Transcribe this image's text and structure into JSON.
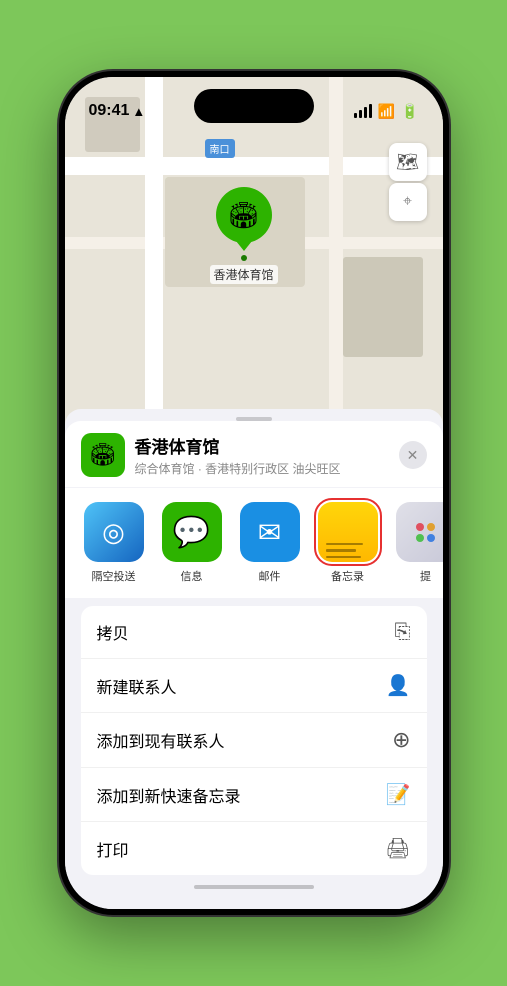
{
  "status_bar": {
    "time": "09:41",
    "location_arrow": "▶"
  },
  "map": {
    "label": "南口",
    "label_prefix": "南口"
  },
  "pin": {
    "label": "香港体育馆"
  },
  "venue": {
    "name": "香港体育馆",
    "subtitle": "综合体育馆 · 香港特别行政区 油尖旺区"
  },
  "share_items": [
    {
      "id": "airdrop",
      "label": "隔空投送",
      "type": "airdrop"
    },
    {
      "id": "messages",
      "label": "信息",
      "type": "messages"
    },
    {
      "id": "mail",
      "label": "邮件",
      "type": "mail"
    },
    {
      "id": "notes",
      "label": "备忘录",
      "type": "notes"
    },
    {
      "id": "more",
      "label": "提",
      "type": "more"
    }
  ],
  "actions": [
    {
      "id": "copy",
      "label": "拷贝",
      "icon": "📋"
    },
    {
      "id": "new-contact",
      "label": "新建联系人",
      "icon": "👤"
    },
    {
      "id": "add-to-contact",
      "label": "添加到现有联系人",
      "icon": "👤"
    },
    {
      "id": "add-quick-note",
      "label": "添加到新快速备忘录",
      "icon": "📝"
    },
    {
      "id": "print",
      "label": "打印",
      "icon": "🖨️"
    }
  ],
  "labels": {
    "close": "✕",
    "map_control_1": "🗺",
    "map_control_2": "➤"
  }
}
